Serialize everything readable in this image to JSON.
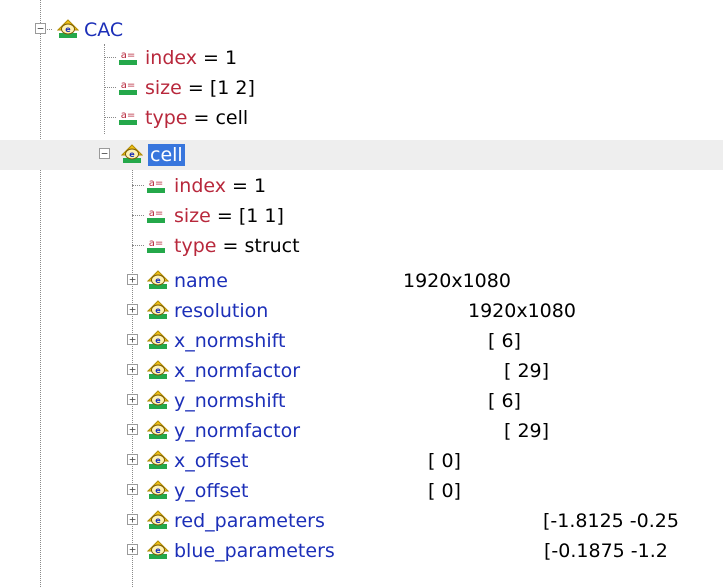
{
  "tree": {
    "root": {
      "label": "CAC"
    },
    "root_props": [
      {
        "name": "index",
        "value": "1"
      },
      {
        "name": "size",
        "value": "[1 2]"
      },
      {
        "name": "type",
        "value": "cell"
      }
    ],
    "cell_node": {
      "label": "cell",
      "selected": true
    },
    "cell_props": [
      {
        "name": "index",
        "value": "1"
      },
      {
        "name": "size",
        "value": "[1 1]"
      },
      {
        "name": "type",
        "value": "struct"
      }
    ],
    "fields": [
      {
        "name": "name",
        "value": "1920x1080"
      },
      {
        "name": "resolution",
        "value": "1920x1080"
      },
      {
        "name": "x_normshift",
        "value": "[ 6]"
      },
      {
        "name": "x_normfactor",
        "value": "[ 29]"
      },
      {
        "name": "y_normshift",
        "value": "[ 6]"
      },
      {
        "name": "y_normfactor",
        "value": "[ 29]"
      },
      {
        "name": "x_offset",
        "value": "[ 0]"
      },
      {
        "name": "y_offset",
        "value": "[ 0]"
      },
      {
        "name": "red_parameters",
        "value": "[-1.8125 -0.25"
      },
      {
        "name": "blue_parameters",
        "value": "[-0.1875 -1.2"
      }
    ],
    "equals_sign": "=",
    "expander_collapsed": "+",
    "expander_expanded": "−",
    "icons": {
      "struct": "struct-node-icon",
      "property": "property-icon"
    },
    "colors": {
      "struct_label": "#1c2fb8",
      "property_name": "#b8283c",
      "selection": "#3876dd"
    }
  }
}
